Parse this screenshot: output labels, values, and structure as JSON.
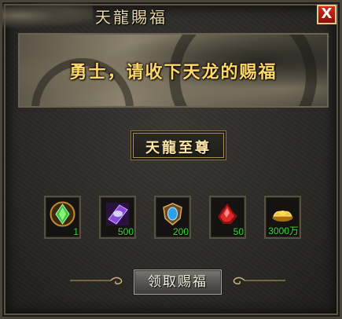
{
  "window": {
    "title": "天龍賜福",
    "close_label": "X"
  },
  "banner": {
    "text": "勇士，请收下天龙的赐福"
  },
  "rank": {
    "label": "天龍至尊"
  },
  "rewards": [
    {
      "icon": "green-gem-icon",
      "quantity": "1"
    },
    {
      "icon": "purple-crystal-icon",
      "quantity": "500"
    },
    {
      "icon": "blue-shield-gem-icon",
      "quantity": "200"
    },
    {
      "icon": "red-crystal-icon",
      "quantity": "50"
    },
    {
      "icon": "gold-ingot-icon",
      "quantity": "3000万"
    }
  ],
  "claim_button": {
    "label": "领取赐福"
  },
  "colors": {
    "title_text": "#e9d7a8",
    "banner_text": "#ffd86b",
    "quantity_text": "#30e030",
    "close_button": "#c8190c"
  }
}
